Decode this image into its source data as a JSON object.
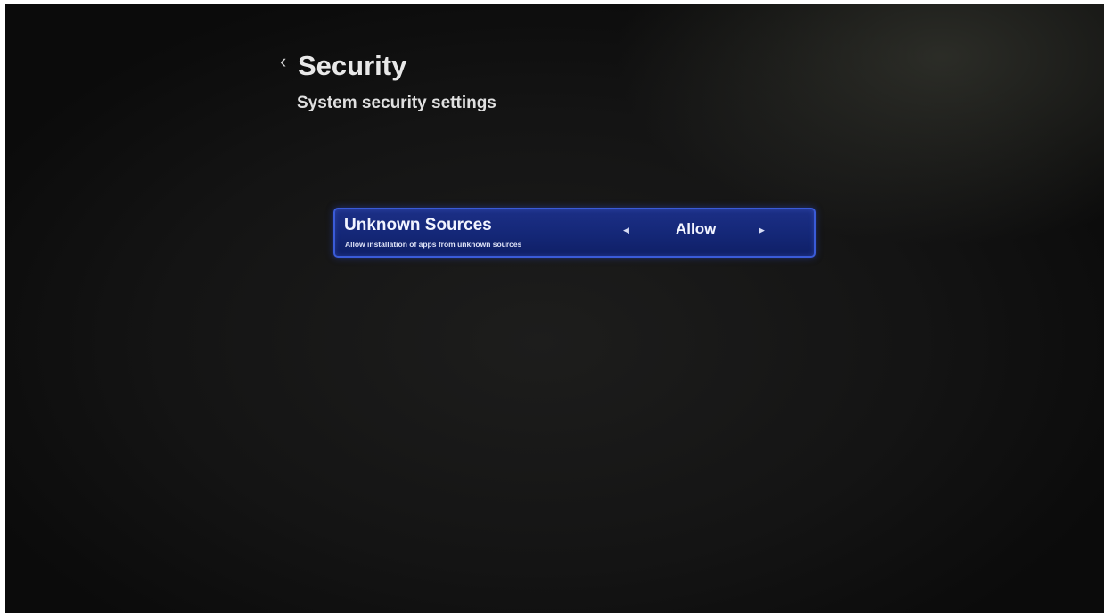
{
  "header": {
    "back_glyph": "‹",
    "back_icon": "chevron-left-icon",
    "title": "Security",
    "subtitle": "System security settings"
  },
  "settings": [
    {
      "title": "Unknown Sources",
      "description": "Allow installation of apps from unknown sources",
      "value": "Allow",
      "prev_glyph": "◀",
      "next_glyph": "▶",
      "prev_icon": "arrow-left-icon",
      "next_icon": "arrow-right-icon"
    }
  ],
  "colors": {
    "background": "#141414",
    "row_fill": "#142777",
    "row_border": "#3a5bd8",
    "text": "#e8e8e8"
  }
}
